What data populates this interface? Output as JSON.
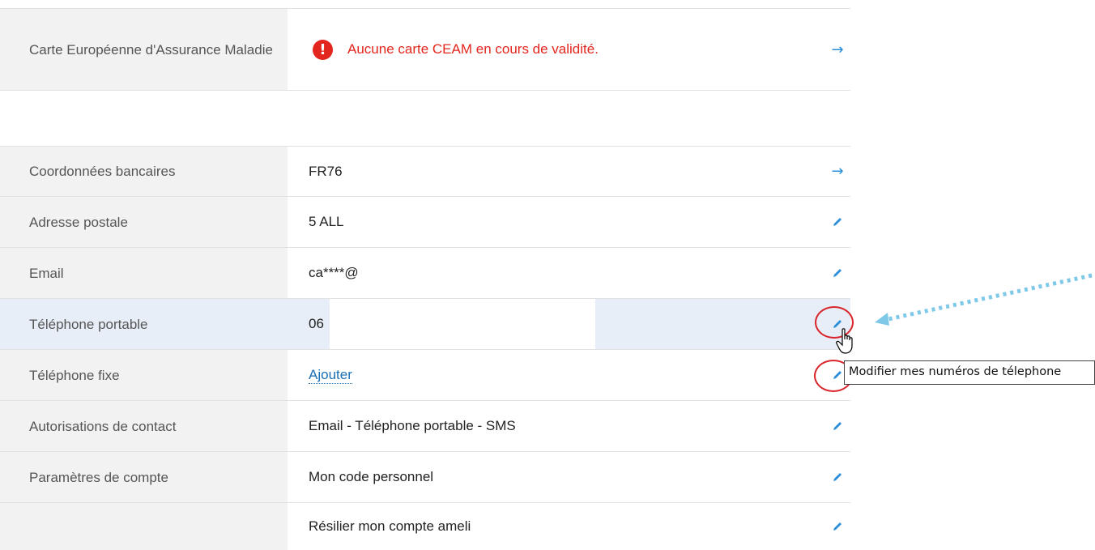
{
  "ceam": {
    "label": "Carte Européenne d'Assurance Maladie",
    "message": "Aucune carte CEAM en cours de validité.",
    "alert_icon": "!",
    "action_icon": "arrow-right-icon"
  },
  "rows": [
    {
      "label": "Coordonnées bancaires",
      "value": "FR76",
      "action_icon": "arrow-right-icon"
    },
    {
      "label": "Adresse postale",
      "value": "5 ALL",
      "action_icon": "pencil-icon"
    },
    {
      "label": "Email",
      "value": "ca****@",
      "action_icon": "pencil-icon"
    },
    {
      "label": "Téléphone portable",
      "value": "06",
      "action_icon": "pencil-icon"
    },
    {
      "label": "Téléphone fixe",
      "value": "Ajouter",
      "action_icon": "pencil-icon"
    },
    {
      "label": "Autorisations de contact",
      "value": "Email - Téléphone portable - SMS",
      "action_icon": "pencil-icon"
    },
    {
      "label": "Paramètres de compte",
      "value": "Mon code personnel",
      "action_icon": "pencil-icon"
    },
    {
      "label": "",
      "value": "Résilier mon compte ameli",
      "action_icon": "pencil-icon"
    }
  ],
  "tooltip": "Modifier mes numéros de télephone",
  "colors": {
    "label_bg": "#f2f2f2",
    "highlight_bg": "#e7eef7",
    "alert_red": "#e3261d",
    "link_blue": "#1a6fb5",
    "icon_blue": "#2a8fd8",
    "annotation_red": "#d9262c",
    "annotation_arrow": "#7ec8e8"
  }
}
